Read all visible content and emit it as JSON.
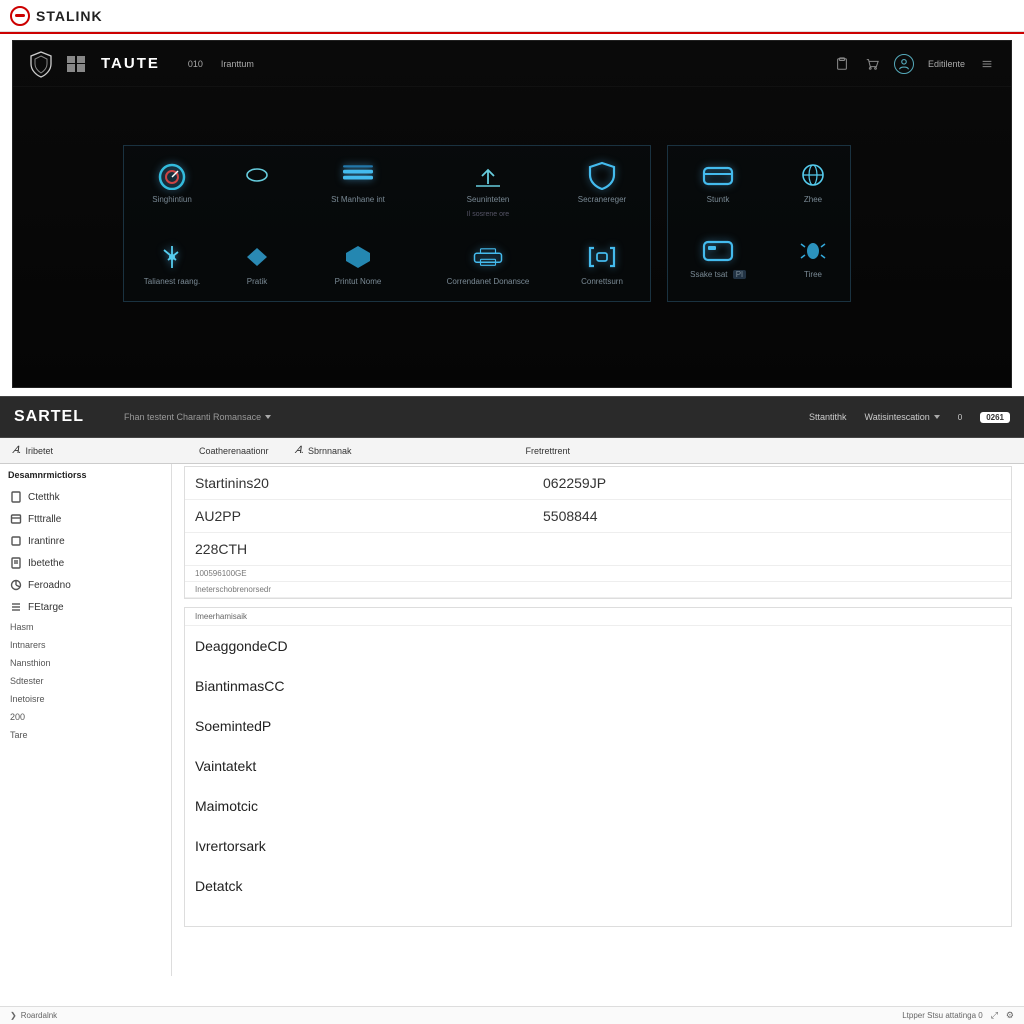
{
  "brand": {
    "name": "STALINK"
  },
  "dash": {
    "title": "TAUTE",
    "nav": [
      "010",
      "Iranttum"
    ],
    "right_label": "Editilente",
    "tiles_main": [
      {
        "label": "Singhintiun",
        "icon": "gauge"
      },
      {
        "label": "",
        "icon": "loop",
        "narrow": true
      },
      {
        "label": "St Manhane int",
        "icon": "bars"
      },
      {
        "label": "Seuninteten",
        "sub": "Il sosrene ore",
        "icon": "arrow-up"
      },
      {
        "label": "Secranereger",
        "icon": "shield"
      },
      {
        "label": "Talianest raang.",
        "icon": "spark"
      },
      {
        "label": "Pratik",
        "icon": "diamond",
        "narrow": true
      },
      {
        "label": "Printut Nome",
        "icon": "hex"
      },
      {
        "label": "Correndanet Donansce",
        "icon": "printer"
      },
      {
        "label": "Conrettsurn",
        "icon": "bracket"
      }
    ],
    "tiles_side": [
      {
        "label": "Stuntk",
        "icon": "card"
      },
      {
        "label": "Zhee",
        "icon": "globe",
        "narrow": true
      },
      {
        "label": "Ssake tsat",
        "icon": "card2",
        "badge": "Pl"
      },
      {
        "label": "Tiree",
        "icon": "bug",
        "narrow": true
      }
    ]
  },
  "midbar": {
    "logo": "SARTEL",
    "dropdown": "Fhan testent Charanti Romansace",
    "status": "Sttantithk",
    "menu": "Watisintescation",
    "tag": "0",
    "badge": "0261"
  },
  "tabs": [
    "Iribetet",
    "Coatherenaationr",
    "Sbrnnanak",
    "Fretrettrent"
  ],
  "sidebar": {
    "heading": "Desamnrmictiorss",
    "items": [
      {
        "label": "Ctetthk",
        "icon": "doc"
      },
      {
        "label": "Ftttralle",
        "icon": "box"
      },
      {
        "label": "Irantinre",
        "icon": "box2"
      },
      {
        "label": "Ibetethe",
        "icon": "note"
      },
      {
        "label": "Feroadno",
        "icon": "pie"
      },
      {
        "label": "FEtarge",
        "icon": "list"
      }
    ],
    "plain": [
      "Hasm",
      "Intnarers",
      "Nansthion",
      "Sdtester",
      "Inetoisre",
      "200",
      "Tare"
    ]
  },
  "detail": {
    "rows": [
      {
        "k": "Startinins20",
        "v": "062259JP"
      },
      {
        "k": "AU2PP",
        "v": "5508844"
      },
      {
        "k": "228CTH",
        "v": ""
      }
    ],
    "sub1": "100596100GE",
    "sub2": "Ineterschobrenorsedr",
    "list_head": "Imeerhamisaik",
    "list": [
      "DeaggondeCD",
      "BiantinmasCC",
      "SoemintedP",
      "Vaintatekt",
      "Maimotcic",
      "Ivrertorsark",
      "Detatck"
    ]
  },
  "status": {
    "left": "Roardalnk",
    "right": "Ltpper Stsu attatinga 0"
  }
}
